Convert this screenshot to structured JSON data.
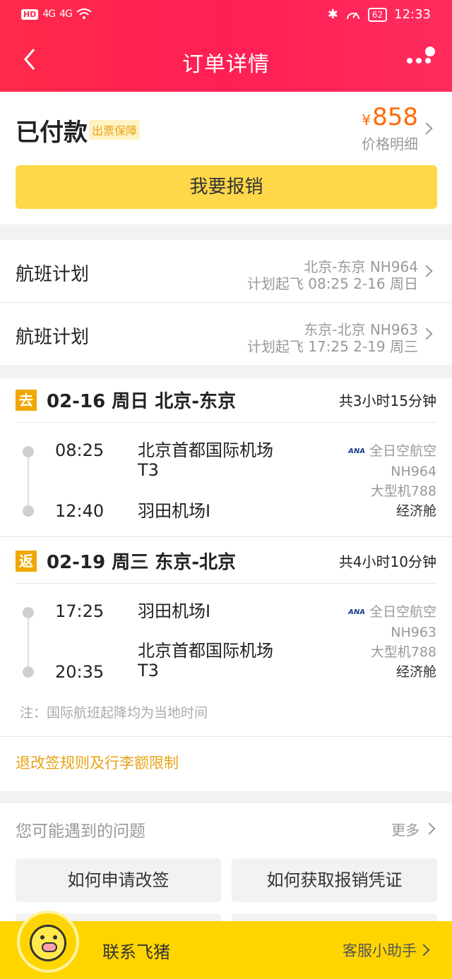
{
  "status_bar": {
    "left": "HD",
    "signal1": "4G",
    "signal2": "4G",
    "battery": "62",
    "time": "12:33"
  },
  "header": {
    "title": "订单详情"
  },
  "order": {
    "status": "已付款",
    "guarantee_badge": "出票保障",
    "currency": "¥",
    "price": "858",
    "price_detail": "价格明细",
    "reimburse_button": "我要报销"
  },
  "flight_plans": [
    {
      "label": "航班计划",
      "route": "北京-东京 NH964",
      "schedule": "计划起飞 08:25 2-16 周日"
    },
    {
      "label": "航班计划",
      "route": "东京-北京 NH963",
      "schedule": "计划起飞 17:25 2-19 周三"
    }
  ],
  "segments": [
    {
      "badge": "去",
      "title": "02-16 周日 北京-东京",
      "duration": "共3小时15分钟",
      "dep_time": "08:25",
      "dep_airport": "北京首都国际机场",
      "dep_terminal": "T3",
      "arr_time": "12:40",
      "arr_airport": "羽田机场I",
      "arr_terminal": "",
      "airline_logo": "ANA",
      "airline": "全日空航空",
      "flight_no": "NH964",
      "aircraft": "大型机788",
      "cabin": "经济舱"
    },
    {
      "badge": "返",
      "title": "02-19 周三 东京-北京",
      "duration": "共4小时10分钟",
      "dep_time": "17:25",
      "dep_airport": "羽田机场I",
      "dep_terminal": "",
      "arr_time": "20:35",
      "arr_airport": "北京首都国际机场",
      "arr_terminal": "T3",
      "airline_logo": "ANA",
      "airline": "全日空航空",
      "flight_no": "NH963",
      "aircraft": "大型机788",
      "cabin": "经济舱"
    }
  ],
  "note": "注：国际航班起降均为当地时间",
  "rules_link": "退改签规则及行李额限制",
  "faq": {
    "title": "您可能遇到的问题",
    "more": "更多",
    "items": [
      "如何申请改签",
      "如何获取报销凭证"
    ]
  },
  "bottom_bar": {
    "contact": "联系飞猪",
    "helper": "客服小助手"
  },
  "colors": {
    "header": "#ff2a4a",
    "accent": "#ff6a00",
    "badge": "#f0a800",
    "button": "#ffd84a",
    "bottom": "#ffd500"
  }
}
